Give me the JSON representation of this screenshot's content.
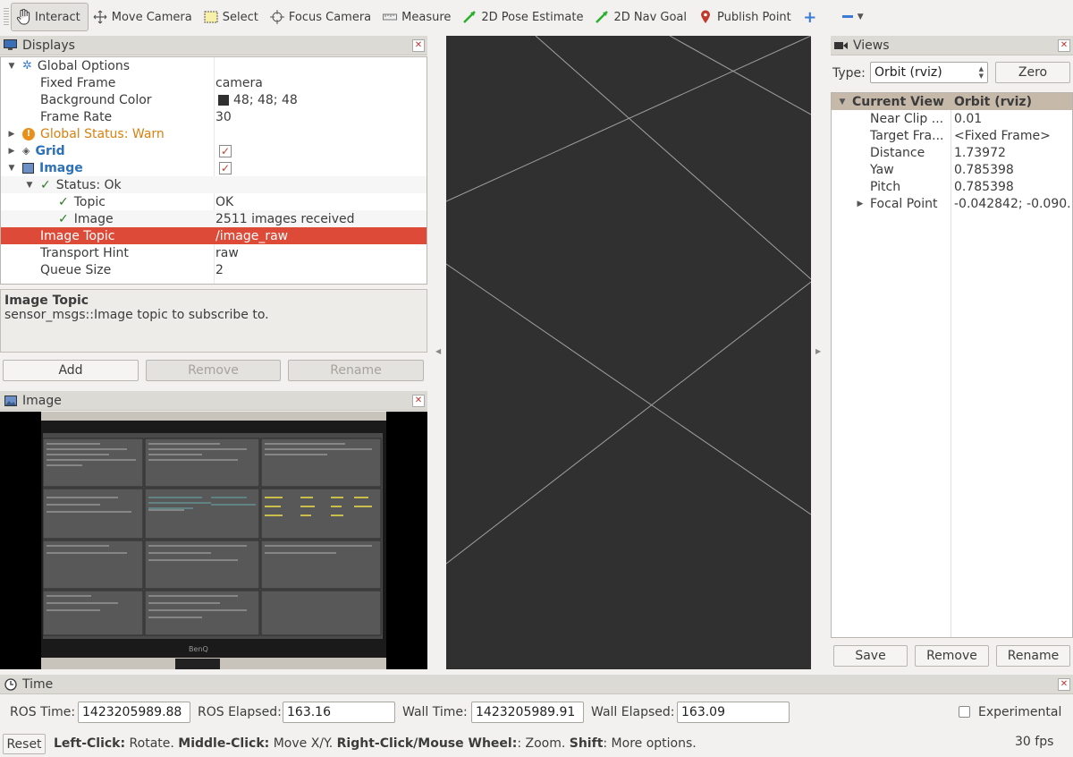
{
  "toolbar": {
    "tools": [
      {
        "label": "Interact",
        "icon": "hand-pointer-icon"
      },
      {
        "label": "Move Camera",
        "icon": "move-arrows-icon"
      },
      {
        "label": "Select",
        "icon": "select-rect-icon"
      },
      {
        "label": "Focus Camera",
        "icon": "focus-target-icon"
      },
      {
        "label": "Measure",
        "icon": "ruler-icon"
      },
      {
        "label": "2D Pose Estimate",
        "icon": "green-arrow-icon"
      },
      {
        "label": "2D Nav Goal",
        "icon": "green-arrow-icon"
      },
      {
        "label": "Publish Point",
        "icon": "map-pin-icon"
      }
    ]
  },
  "displays": {
    "title": "Displays",
    "rows": [
      {
        "name": "Global Options",
        "value": ""
      },
      {
        "name": "Fixed Frame",
        "value": "camera"
      },
      {
        "name": "Background Color",
        "value": "48; 48; 48"
      },
      {
        "name": "Frame Rate",
        "value": "30"
      },
      {
        "name": "Global Status: Warn",
        "value": ""
      },
      {
        "name": "Grid",
        "value": ""
      },
      {
        "name": "Image",
        "value": ""
      },
      {
        "name": "Status: Ok",
        "value": ""
      },
      {
        "name": "Topic",
        "value": "OK"
      },
      {
        "name": "Image",
        "value": "2511 images received"
      },
      {
        "name": "Image Topic",
        "value": "/image_raw"
      },
      {
        "name": "Transport Hint",
        "value": "raw"
      },
      {
        "name": "Queue Size",
        "value": "2"
      }
    ],
    "description_title": "Image Topic",
    "description_text": "sensor_msgs::Image topic to subscribe to.",
    "add_label": "Add",
    "remove_label": "Remove",
    "rename_label": "Rename"
  },
  "image_panel": {
    "title": "Image",
    "monitor_brand": "BenQ"
  },
  "views": {
    "title": "Views",
    "type_label": "Type:",
    "type_value": "Orbit (rviz)",
    "zero_label": "Zero",
    "header_name": "Current View",
    "header_value": "Orbit (rviz)",
    "rows": [
      {
        "name": "Near Clip ...",
        "value": "0.01"
      },
      {
        "name": "Target Fra...",
        "value": "<Fixed Frame>"
      },
      {
        "name": "Distance",
        "value": "1.73972"
      },
      {
        "name": "Yaw",
        "value": "0.785398"
      },
      {
        "name": "Pitch",
        "value": "0.785398"
      },
      {
        "name": "Focal Point",
        "value": "-0.042842; -0.090..."
      }
    ],
    "save_label": "Save",
    "remove_label": "Remove",
    "rename_label": "Rename"
  },
  "time": {
    "title": "Time",
    "ros_time_label": "ROS Time:",
    "ros_time": "1423205989.88",
    "ros_elapsed_label": "ROS Elapsed:",
    "ros_elapsed": "163.16",
    "wall_time_label": "Wall Time:",
    "wall_time": "1423205989.91",
    "wall_elapsed_label": "Wall Elapsed:",
    "wall_elapsed": "163.09",
    "experimental_label": "Experimental"
  },
  "status": {
    "reset_label": "Reset",
    "k1": "Left-Click:",
    "v1": " Rotate. ",
    "k2": "Middle-Click:",
    "v2": " Move X/Y. ",
    "k3": "Right-Click/Mouse Wheel:",
    "v3": ": Zoom. ",
    "k4": "Shift",
    "v4": ": More options.",
    "fps": "30 fps"
  },
  "colors": {
    "selection": "#dd4a38",
    "viewport_bg": "#303030",
    "grid_line": "#a0a0a0"
  }
}
